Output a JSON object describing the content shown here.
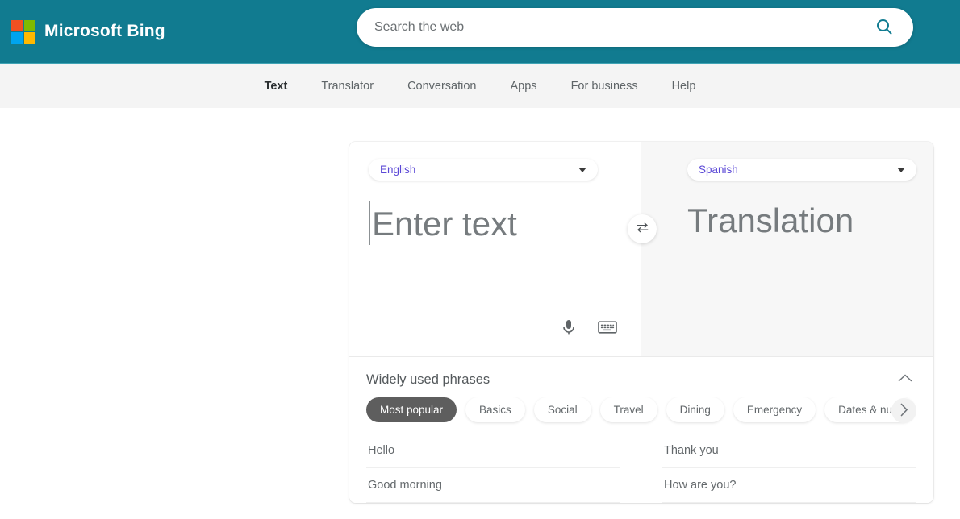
{
  "header": {
    "brand_name": "Microsoft Bing",
    "logo_colors": [
      "#f25022",
      "#7fba00",
      "#00a4ef",
      "#ffb900"
    ],
    "bg_color": "#117b90",
    "search": {
      "placeholder": "Search the web",
      "value": "",
      "icon": "search-icon",
      "icon_color": "#0f7b90"
    }
  },
  "nav": {
    "items": [
      {
        "label": "Text",
        "active": true
      },
      {
        "label": "Translator",
        "active": false
      },
      {
        "label": "Conversation",
        "active": false
      },
      {
        "label": "Apps",
        "active": false
      },
      {
        "label": "For business",
        "active": false
      },
      {
        "label": "Help",
        "active": false
      }
    ]
  },
  "translator": {
    "source": {
      "language": "English",
      "placeholder": "Enter text",
      "tools": [
        {
          "name": "microphone-icon",
          "label": "Microphone"
        },
        {
          "name": "keyboard-icon",
          "label": "Keyboard"
        }
      ]
    },
    "target": {
      "language": "Spanish",
      "placeholder": "Translation"
    },
    "swap": {
      "icon": "swap-arrows-icon",
      "label": "Swap languages"
    },
    "dropdown_text_color": "#5b48d6"
  },
  "phrases": {
    "title": "Widely used phrases",
    "collapse_icon": "chevron-up-icon",
    "next_icon": "chevron-right-icon",
    "categories": [
      {
        "label": "Most popular",
        "active": true
      },
      {
        "label": "Basics",
        "active": false
      },
      {
        "label": "Social",
        "active": false
      },
      {
        "label": "Travel",
        "active": false
      },
      {
        "label": "Dining",
        "active": false
      },
      {
        "label": "Emergency",
        "active": false
      },
      {
        "label": "Dates & num",
        "active": false
      }
    ],
    "items": [
      "Hello",
      "Thank you",
      "Good morning",
      "How are you?"
    ]
  }
}
